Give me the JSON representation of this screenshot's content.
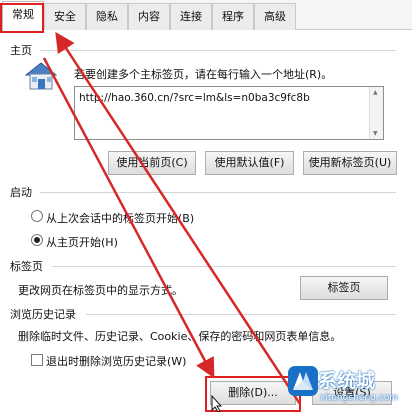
{
  "tabs": [
    "常规",
    "安全",
    "隐私",
    "内容",
    "连接",
    "程序",
    "高级"
  ],
  "home_page": {
    "section_label": "主页",
    "instruction": "若要创建多个主标签页，请在每行输入一个地址(R)。",
    "url_value": "http://hao.360.cn/?src=lm&ls=n0ba3c9fc8b",
    "buttons": [
      "使用当前页(C)",
      "使用默认值(F)",
      "使用新标签页(U)"
    ]
  },
  "startup": {
    "section_label": "启动",
    "options": [
      "从上次会话中的标签页开始(B)",
      "从主页开始(H)"
    ],
    "selected_index": 1
  },
  "tabs_section": {
    "section_label": "标签页",
    "description": "更改网页在标签页中的显示方式。",
    "button": "标签页"
  },
  "history": {
    "section_label": "浏览历史记录",
    "description": "删除临时文件、历史记录、Cookie、保存的密码和网页表单信息。",
    "checkbox_label": "退出时删除浏览历史记录(W)",
    "checkbox_checked": false,
    "delete_button": "删除(D)...",
    "settings_button": "设置(S)"
  },
  "watermark": {
    "brand": "系统城",
    "domain": "xitongcheng.com"
  },
  "colors": {
    "highlight": "#e02020",
    "arrow": "#d62828",
    "watermark_blue": "#1a6fc7"
  }
}
